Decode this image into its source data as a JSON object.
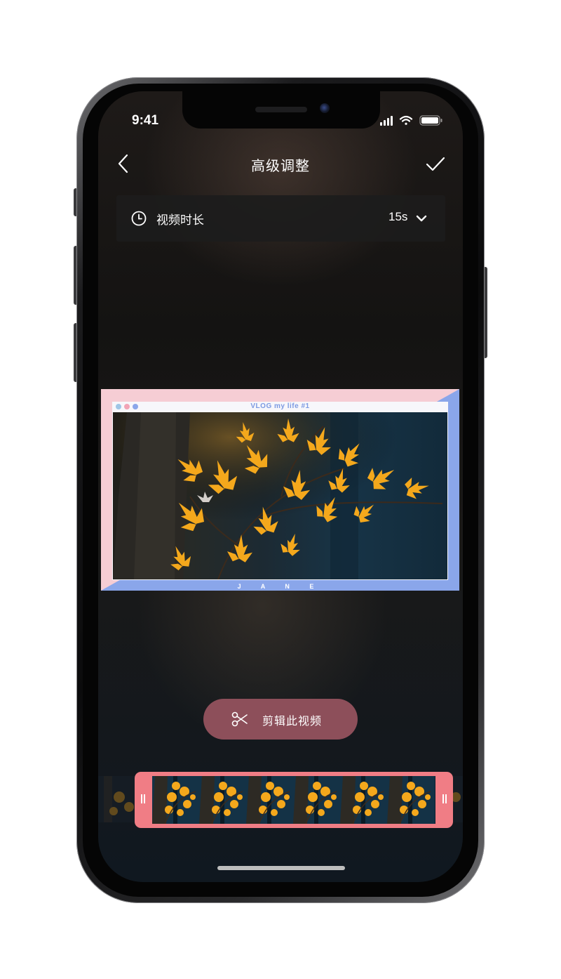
{
  "status_bar": {
    "time": "9:41"
  },
  "nav": {
    "title": "高级调整"
  },
  "duration": {
    "label": "视频时长",
    "value": "15s"
  },
  "preview": {
    "window_title": "VLOG my life #1",
    "footer": "J A N E"
  },
  "actions": {
    "trim_label": "剪辑此视频"
  },
  "colors": {
    "card_pink": "#f6cdd4",
    "card_blue": "#7c9ae2",
    "trim_button": "#8d4f5a",
    "trimmer": "#f07d85",
    "leaf": "#f4a81c"
  },
  "icons": [
    "back-chevron-icon",
    "checkmark-icon",
    "clock-icon",
    "chevron-down-icon",
    "scissors-icon",
    "signal-icon",
    "wifi-icon",
    "battery-icon"
  ]
}
